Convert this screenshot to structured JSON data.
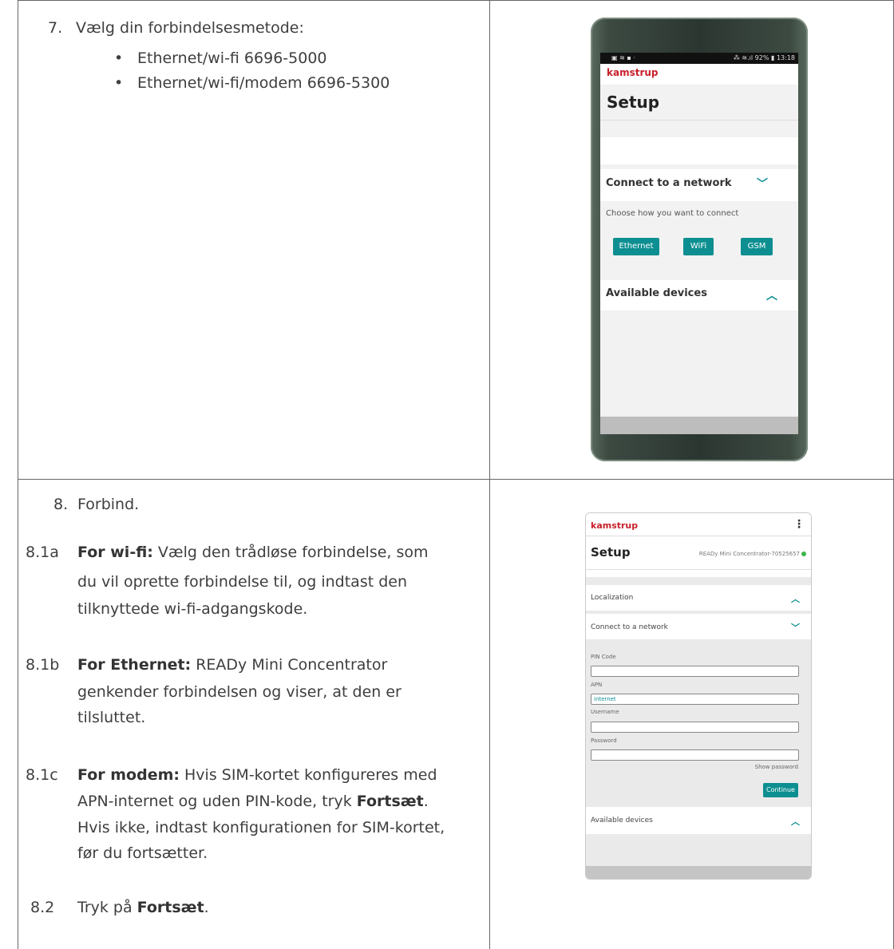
{
  "step7": {
    "number": "7.",
    "text": "Vælg din forbindelsesmetode:",
    "bullets": [
      "Ethernet/wi-fi 6696-5000",
      "Ethernet/wi-fi/modem 6696-5300"
    ]
  },
  "step8": {
    "number": "8.",
    "text": "Forbind.",
    "sub_a": {
      "number": "8.1a",
      "bold": "For wi-fi:",
      "text": " Vælg den trådløse forbindelse, som",
      "line2": "du vil oprette forbindelse til, og indtast den",
      "line3": "tilknyttede wi-fi-adgangskode."
    },
    "sub_b": {
      "number": "8.1b",
      "bold": "For Ethernet:",
      "text": " READy Mini Concentrator",
      "line2": "genkender forbindelsen og viser, at den er",
      "line3": "tilsluttet."
    },
    "sub_c": {
      "number": "8.1c",
      "bold": "For modem:",
      "text": " Hvis SIM-kortet konfigureres med",
      "line2a": "APN-internet og uden PIN-kode, tryk ",
      "line2b": "Fortsæt",
      "line2c": ".",
      "line3": "Hvis ikke, indtast konfigurationen for SIM-kortet,",
      "line4": "før du fortsætter."
    },
    "sub_2": {
      "number": "8.2",
      "text": "Tryk på ",
      "bold": "Fortsæt",
      "end": "."
    }
  },
  "phone1": {
    "status_left": "▣ ≋ ▪ ·",
    "status_right": "⁂ ≋.ıl 92% ▮ 13:18",
    "brand": "kamstrup",
    "title": "Setup",
    "section_label": "Connect to a network",
    "choose_text": "Choose how you want to connect",
    "buttons": [
      "Ethernet",
      "WiFi",
      "GSM"
    ],
    "available_label": "Available devices"
  },
  "phone2": {
    "brand": "kamstrup",
    "menu": "⋮",
    "title": "Setup",
    "device": "READy Mini Concentrator-70525657",
    "localization": "Localization",
    "connect": "Connect to a network",
    "pin_label": "PIN Code",
    "apn_label": "APN",
    "apn_value": "internet",
    "username_label": "Username",
    "password_label": "Password",
    "show_password": "Show password",
    "continue": "Continue",
    "available": "Available devices"
  },
  "colors": {
    "accent": "#0d8f91",
    "brand": "#c8202b",
    "status_ok": "#3cb54a"
  }
}
